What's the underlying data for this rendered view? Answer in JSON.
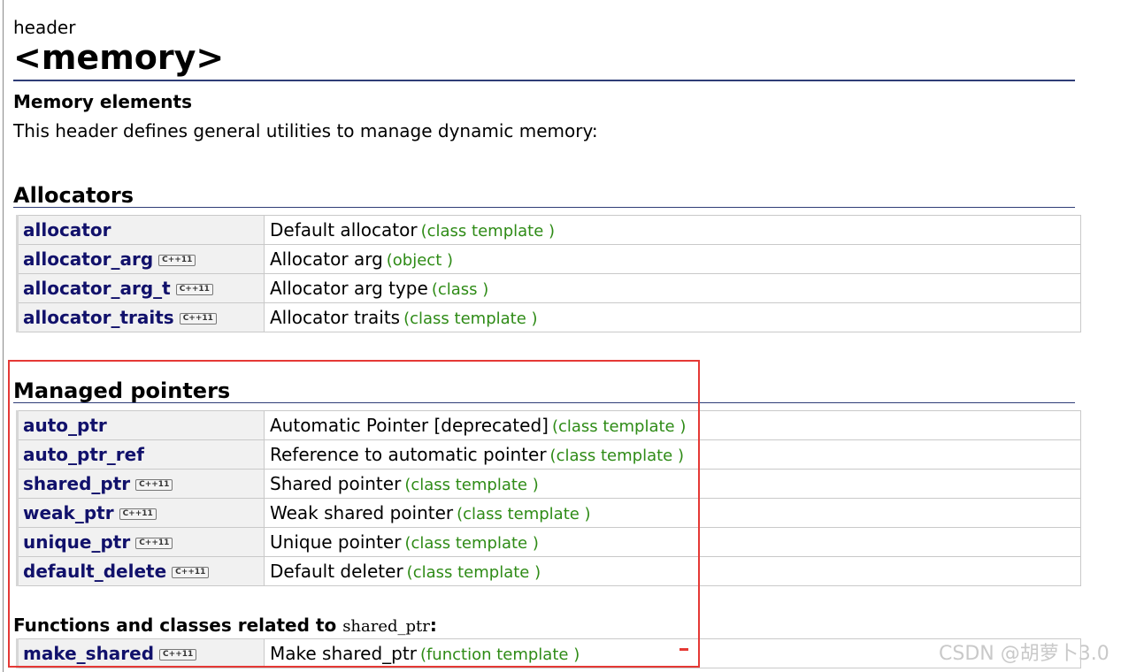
{
  "header": {
    "kind": "header",
    "title": "<memory>"
  },
  "memory_elements": {
    "title": "Memory elements",
    "description": "This header defines general utilities to manage dynamic memory:"
  },
  "allocators": {
    "title": "Allocators",
    "rows": [
      {
        "name": "allocator",
        "cpp11": false,
        "desc": "Default allocator",
        "kind": "(class template )"
      },
      {
        "name": "allocator_arg",
        "cpp11": true,
        "desc": "Allocator arg",
        "kind": "(object )"
      },
      {
        "name": "allocator_arg_t",
        "cpp11": true,
        "desc": "Allocator arg type",
        "kind": "(class )"
      },
      {
        "name": "allocator_traits",
        "cpp11": true,
        "desc": "Allocator traits",
        "kind": "(class template )"
      }
    ]
  },
  "managed_pointers": {
    "title": "Managed pointers",
    "rows": [
      {
        "name": "auto_ptr",
        "cpp11": false,
        "desc": "Automatic Pointer [deprecated]",
        "kind": "(class template )"
      },
      {
        "name": "auto_ptr_ref",
        "cpp11": false,
        "desc": "Reference to automatic pointer",
        "kind": "(class template )"
      },
      {
        "name": "shared_ptr",
        "cpp11": true,
        "desc": "Shared pointer",
        "kind": "(class template )"
      },
      {
        "name": "weak_ptr",
        "cpp11": true,
        "desc": "Weak shared pointer",
        "kind": "(class template )"
      },
      {
        "name": "unique_ptr",
        "cpp11": true,
        "desc": "Unique pointer",
        "kind": "(class template )"
      },
      {
        "name": "default_delete",
        "cpp11": true,
        "desc": "Default deleter",
        "kind": "(class template )"
      }
    ]
  },
  "shared_ptr_related": {
    "title_prefix": "Functions and classes related to",
    "title_code": "shared_ptr",
    "title_suffix": ":",
    "rows": [
      {
        "name": "make_shared",
        "cpp11": true,
        "desc": "Make shared_ptr",
        "kind": "(function template )"
      }
    ]
  },
  "badge_label": "C++11",
  "watermark": "CSDN @胡萝卜3.0",
  "colors": {
    "link": "#11116b",
    "kind": "#2e8b16",
    "rule": "#2f3d77",
    "highlight": "#e53935"
  }
}
